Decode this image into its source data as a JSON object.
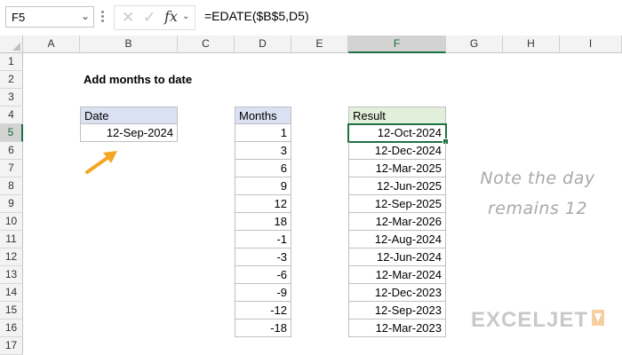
{
  "formula_bar": {
    "name_box": "F5",
    "formula": "=EDATE($B$5,D5)",
    "fx_label": "fx"
  },
  "columns": [
    "A",
    "B",
    "C",
    "D",
    "E",
    "F",
    "G",
    "H",
    "I"
  ],
  "selected_column": "F",
  "rows": [
    "1",
    "2",
    "3",
    "4",
    "5",
    "6",
    "7",
    "8",
    "9",
    "10",
    "11",
    "12",
    "13",
    "14",
    "15",
    "16",
    "17"
  ],
  "selected_row": "5",
  "sheet": {
    "title": "Add months to date",
    "date_header": "Date",
    "date_value": "12-Sep-2024",
    "months_header": "Months",
    "months": [
      "1",
      "3",
      "6",
      "9",
      "12",
      "18",
      "-1",
      "-3",
      "-6",
      "-9",
      "-12",
      "-18"
    ],
    "result_header": "Result",
    "results": [
      "12-Oct-2024",
      "12-Dec-2024",
      "12-Mar-2025",
      "12-Jun-2025",
      "12-Sep-2025",
      "12-Mar-2026",
      "12-Aug-2024",
      "12-Jun-2024",
      "12-Mar-2024",
      "12-Dec-2023",
      "12-Sep-2023",
      "12-Mar-2023"
    ]
  },
  "note": {
    "line1": "Note the day",
    "line2": "remains 12"
  },
  "logo": "EXCELJET",
  "colors": {
    "accent_green": "#1e7145",
    "arrow_orange": "#f5a623",
    "date_header_fill": "#d9e1f2",
    "result_header_fill": "#e2efda"
  }
}
